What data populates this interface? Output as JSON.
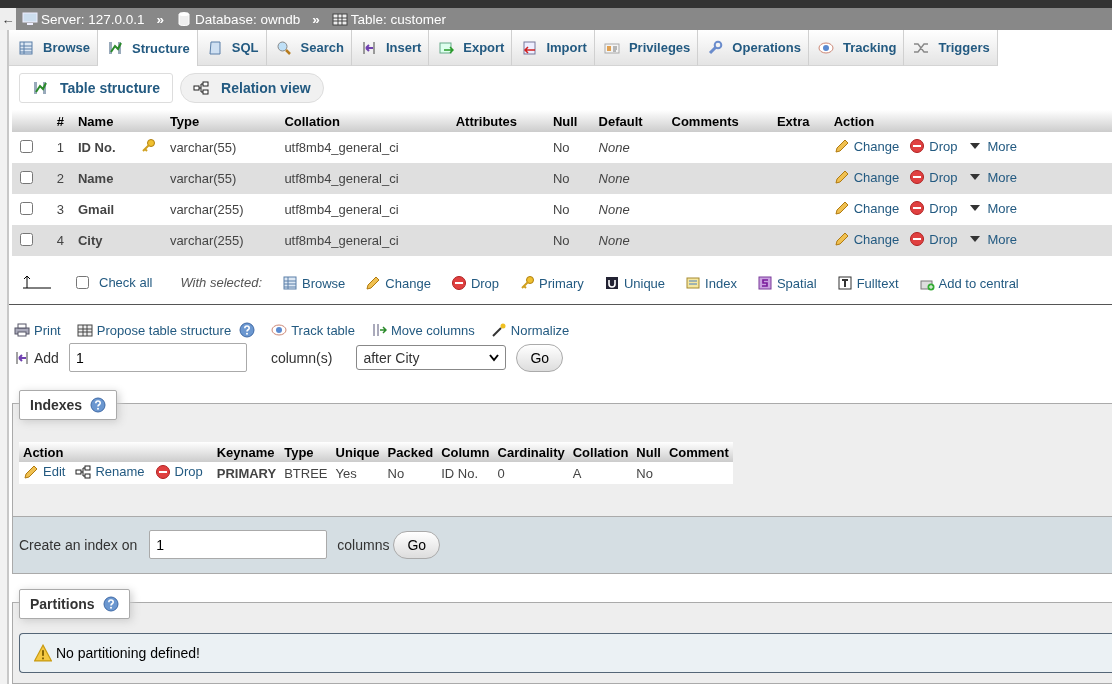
{
  "nav": {
    "back": "←",
    "breadcrumb": [
      {
        "label": "Server: 127.0.0.1"
      },
      {
        "label": "Database: owndb"
      },
      {
        "label": "Table: customer"
      }
    ],
    "separator": "»"
  },
  "tabs": [
    {
      "label": "Browse",
      "selected": false
    },
    {
      "label": "Structure",
      "selected": true
    },
    {
      "label": "SQL",
      "selected": false
    },
    {
      "label": "Search",
      "selected": false
    },
    {
      "label": "Insert",
      "selected": false
    },
    {
      "label": "Export",
      "selected": false
    },
    {
      "label": "Import",
      "selected": false
    },
    {
      "label": "Privileges",
      "selected": false
    },
    {
      "label": "Operations",
      "selected": false
    },
    {
      "label": "Tracking",
      "selected": false
    },
    {
      "label": "Triggers",
      "selected": false
    }
  ],
  "subtabs": [
    {
      "label": "Table structure",
      "selected": true
    },
    {
      "label": "Relation view",
      "selected": false
    }
  ],
  "columns_table": {
    "headers": [
      "#",
      "Name",
      "Type",
      "Collation",
      "Attributes",
      "Null",
      "Default",
      "Comments",
      "Extra",
      "Action"
    ],
    "rows": [
      {
        "checked": false,
        "number": "1",
        "name": "ID No.",
        "primary": true,
        "type": "varchar(55)",
        "collation": "utf8mb4_general_ci",
        "null": "No",
        "default": "None",
        "actions": [
          "Change",
          "Drop",
          "More"
        ]
      },
      {
        "checked": false,
        "number": "2",
        "name": "Name",
        "primary": false,
        "type": "varchar(55)",
        "collation": "utf8mb4_general_ci",
        "null": "No",
        "default": "None",
        "actions": [
          "Change",
          "Drop",
          "More"
        ]
      },
      {
        "checked": false,
        "number": "3",
        "name": "Gmail",
        "primary": false,
        "type": "varchar(255)",
        "collation": "utf8mb4_general_ci",
        "null": "No",
        "default": "None",
        "actions": [
          "Change",
          "Drop",
          "More"
        ]
      },
      {
        "checked": false,
        "number": "4",
        "name": "City",
        "primary": false,
        "type": "varchar(255)",
        "collation": "utf8mb4_general_ci",
        "null": "No",
        "default": "None",
        "actions": [
          "Change",
          "Drop",
          "More"
        ]
      }
    ]
  },
  "bulk": {
    "check_all": {
      "label": "Check all",
      "checked": false
    },
    "with_selected": "With selected:",
    "actions": [
      "Browse",
      "Change",
      "Drop",
      "Primary",
      "Unique",
      "Index",
      "Spatial",
      "Fulltext",
      "Add to central"
    ]
  },
  "tools": [
    "Print",
    "Propose table structure",
    "Track table",
    "Move columns",
    "Normalize"
  ],
  "add_column": {
    "label": "Add",
    "value": "1",
    "unit": "column(s)",
    "position": "after City",
    "button": "Go"
  },
  "indexes": {
    "title": "Indexes",
    "headers": [
      "Action",
      "Keyname",
      "Type",
      "Unique",
      "Packed",
      "Column",
      "Cardinality",
      "Collation",
      "Null",
      "Comment"
    ],
    "rows": [
      {
        "actions": [
          "Edit",
          "Rename",
          "Drop"
        ],
        "keyname": "PRIMARY",
        "type": "BTREE",
        "unique": "Yes",
        "packed": "No",
        "column": "ID No.",
        "cardinality": "0",
        "collation": "A",
        "null": "No"
      }
    ],
    "create": {
      "label": "Create an index on",
      "value": "1",
      "unit": "columns",
      "button": "Go"
    }
  },
  "partitions": {
    "title": "Partitions",
    "message": "No partitioning defined!"
  }
}
